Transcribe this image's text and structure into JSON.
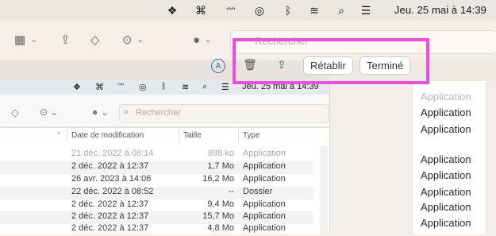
{
  "menubar": {
    "icons": [
      "dropbox-icon",
      "command-icon",
      "airpods-icon",
      "airdrop-icon",
      "bluetooth-icon",
      "wifi-icon",
      "search-icon",
      "control-center-icon"
    ],
    "clock": "Jeu. 25 mai à 14:39"
  },
  "toolbar": {
    "search_placeholder": "Rechercher"
  },
  "editbar": {
    "revert_label": "Rétablir",
    "done_label": "Terminé"
  },
  "right_panel": {
    "rows": [
      "Application",
      "Application",
      "Application",
      "",
      "Application",
      "Application",
      "Application",
      "Application",
      "Application",
      "Application"
    ]
  },
  "inner": {
    "clock": "Jeu. 25 mai à 14:39",
    "search_placeholder": "Rechercher",
    "columns": {
      "date": "Date de modification",
      "size": "Taille",
      "type": "Type"
    },
    "rows": [
      {
        "date": "21 déc. 2022 à 08:14",
        "size": "898 ko",
        "type": "Application",
        "dim": true
      },
      {
        "date": "2 déc. 2022 à 12:37",
        "size": "1,7 Mo",
        "type": "Application",
        "dim": false
      },
      {
        "date": "26 avr. 2023 à 14:06",
        "size": "16,2 Mo",
        "type": "Application",
        "dim": false
      },
      {
        "date": "22 déc. 2022 à 08:52",
        "size": "--",
        "type": "Dossier",
        "dim": false
      },
      {
        "date": "2 déc. 2022 à 12:37",
        "size": "9,4 Mo",
        "type": "Application",
        "dim": false
      },
      {
        "date": "2 déc. 2022 à 12:37",
        "size": "15,7 Mo",
        "type": "Application",
        "dim": false
      },
      {
        "date": "2 déc. 2022 à 12:37",
        "size": "4,8 Mo",
        "type": "Application",
        "dim": false
      }
    ]
  },
  "colors": {
    "highlight": "#ea4fe2",
    "accent": "#2f6fd6"
  }
}
